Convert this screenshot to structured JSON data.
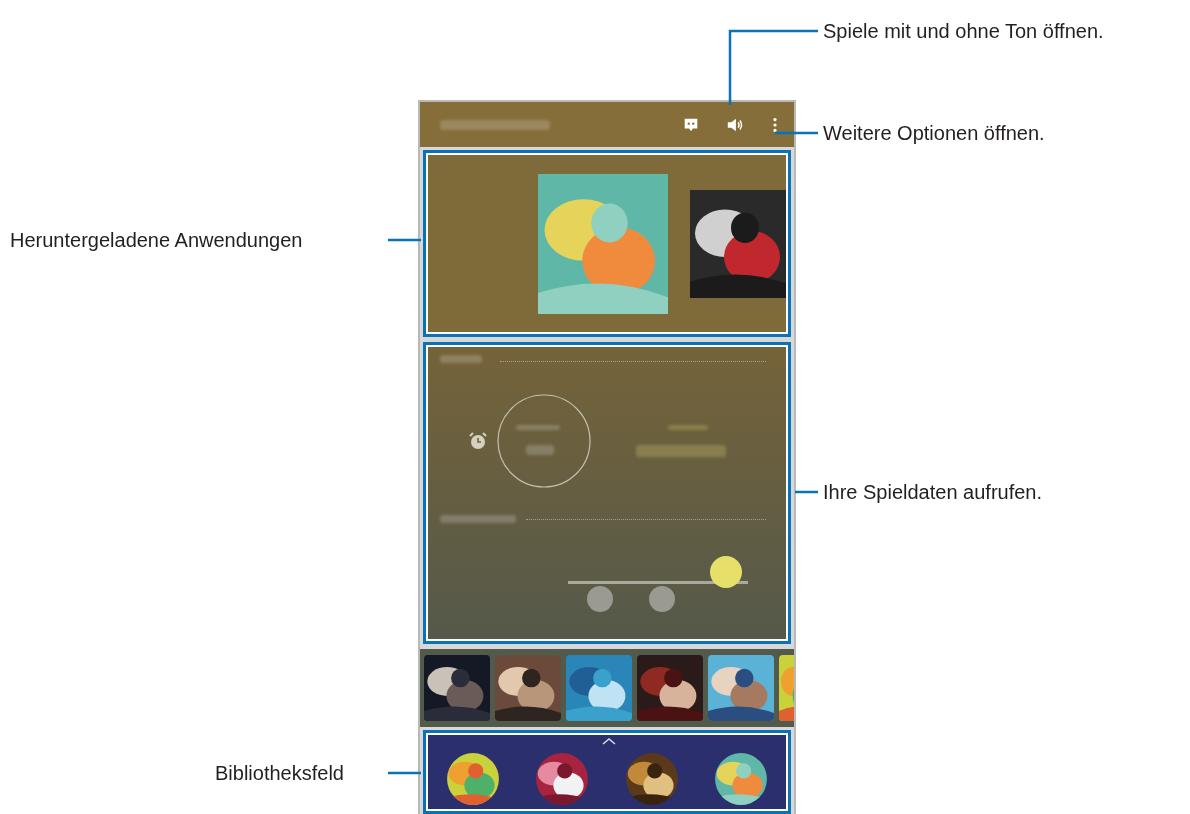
{
  "callouts": [
    {
      "text": "Spiele mit und ohne Ton öffnen."
    },
    {
      "text": "Weitere Optionen öffnen."
    },
    {
      "text": "Heruntergeladene Anwendungen"
    },
    {
      "text": "Ihre Spieldaten aufrufen."
    },
    {
      "text": "Bibliotheksfeld"
    }
  ]
}
